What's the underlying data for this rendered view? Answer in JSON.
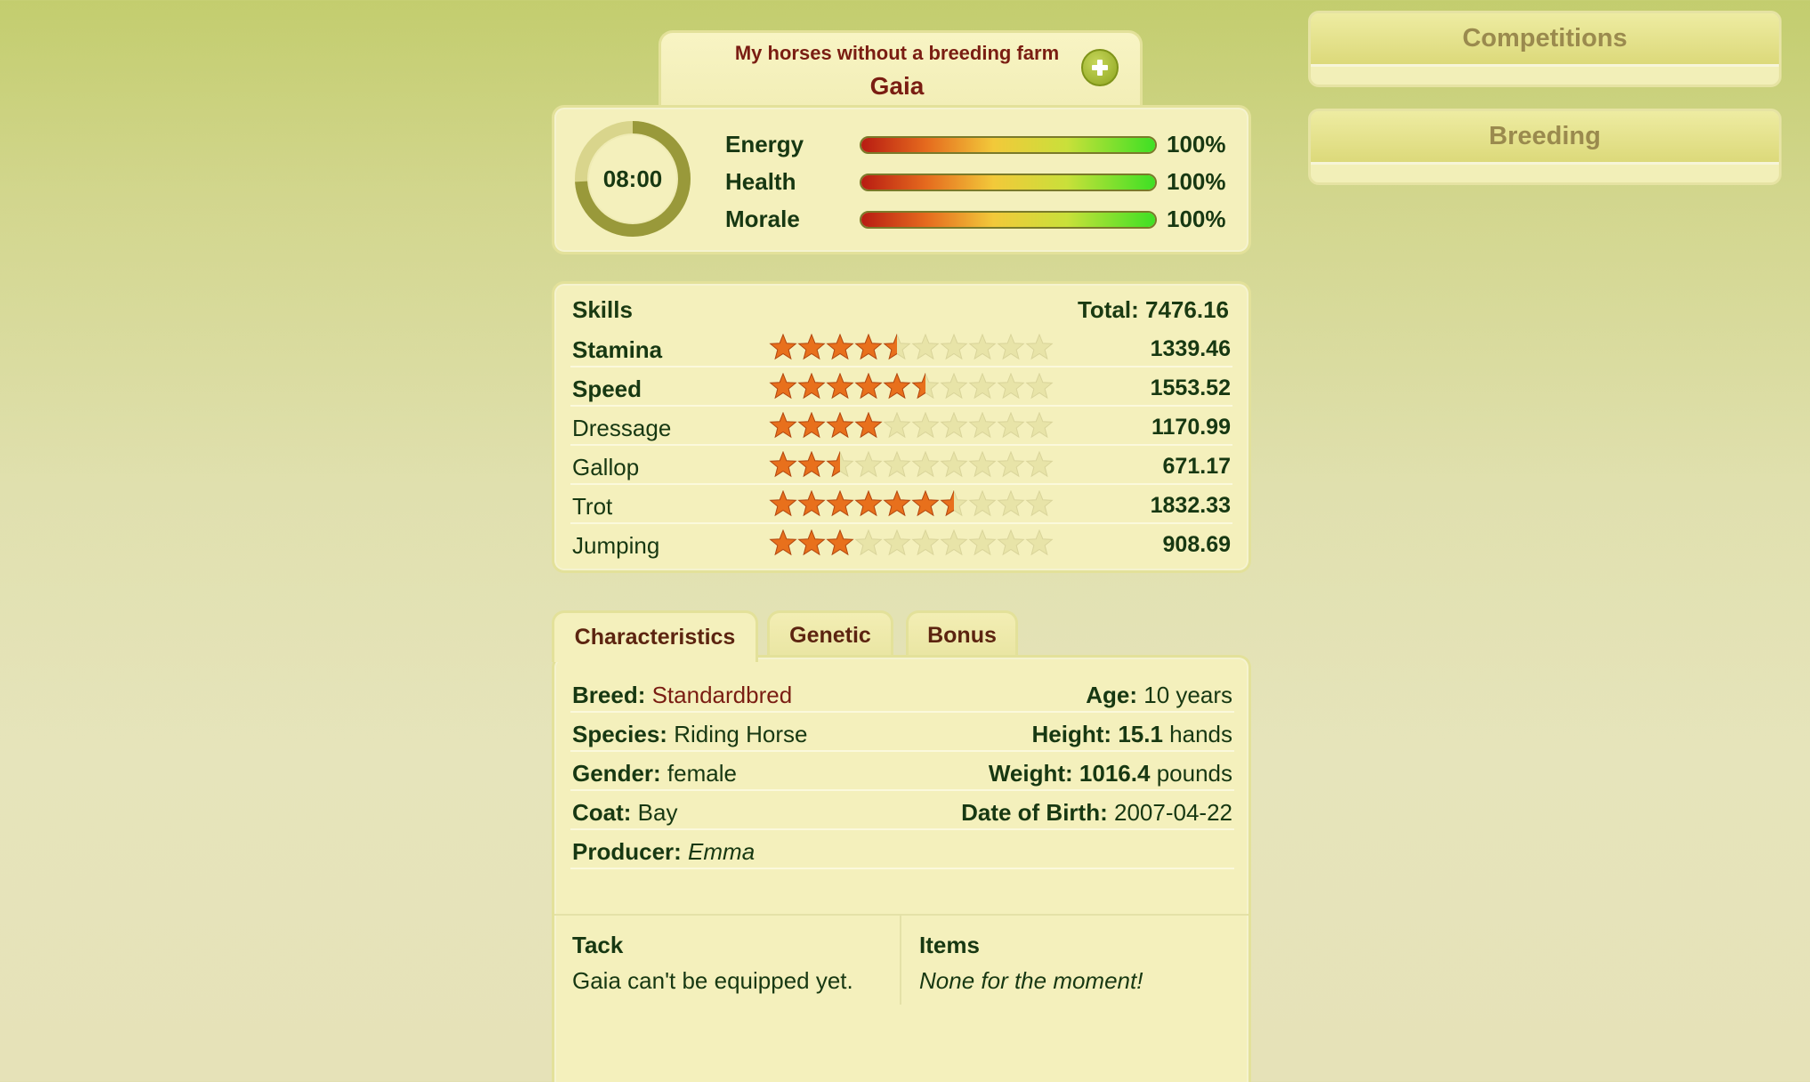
{
  "header": {
    "subtitle": "My horses without a breeding farm",
    "horse_name": "Gaia"
  },
  "status": {
    "clock": "08:00",
    "stats": [
      {
        "label": "Energy",
        "value": "100%",
        "level": 1.0
      },
      {
        "label": "Health",
        "value": "100%",
        "level": 1.0
      },
      {
        "label": "Morale",
        "value": "100%",
        "level": 1.0
      }
    ]
  },
  "skills": {
    "header_label": "Skills",
    "total": "Total: 7476.16",
    "items": [
      {
        "name": "Stamina",
        "value": "1339.46",
        "stars": 4.5,
        "bold": true
      },
      {
        "name": "Speed",
        "value": "1553.52",
        "stars": 5.5,
        "bold": true
      },
      {
        "name": "Dressage",
        "value": "1170.99",
        "stars": 4.0,
        "bold": false
      },
      {
        "name": "Gallop",
        "value": "671.17",
        "stars": 2.5,
        "bold": false
      },
      {
        "name": "Trot",
        "value": "1832.33",
        "stars": 6.5,
        "bold": false
      },
      {
        "name": "Jumping",
        "value": "908.69",
        "stars": 3.0,
        "bold": false
      }
    ],
    "max_stars": 10
  },
  "tabs": {
    "characteristics": "Characteristics",
    "genetic": "Genetic",
    "bonus": "Bonus"
  },
  "characteristics": {
    "breed_label": "Breed:",
    "breed_value": "Standardbred",
    "age_label": "Age:",
    "age_value": "10 years",
    "species_label": "Species:",
    "species_value": "Riding Horse",
    "height_label": "Height:",
    "height_value": "15.1",
    "height_unit": "hands",
    "gender_label": "Gender:",
    "gender_value": "female",
    "weight_label": "Weight:",
    "weight_value": "1016.4",
    "weight_unit": "pounds",
    "coat_label": "Coat:",
    "coat_value": "Bay",
    "dob_label": "Date of Birth:",
    "dob_value": "2007-04-22",
    "producer_label": "Producer:",
    "producer_value": "Emma"
  },
  "tack": {
    "title": "Tack",
    "text": "Gaia can't be equipped yet."
  },
  "items": {
    "title": "Items",
    "text": "None for the moment!"
  },
  "sidebar": {
    "competitions": "Competitions",
    "breeding": "Breeding"
  },
  "colors": {
    "accent_dark_red": "#7a1d12",
    "text_green": "#173812",
    "panel_bg": "#f4f0bc",
    "star_on": "#e8701c",
    "star_off": "#e8e4a8"
  },
  "icons": {
    "add": "plus-icon",
    "star": "star-icon"
  }
}
